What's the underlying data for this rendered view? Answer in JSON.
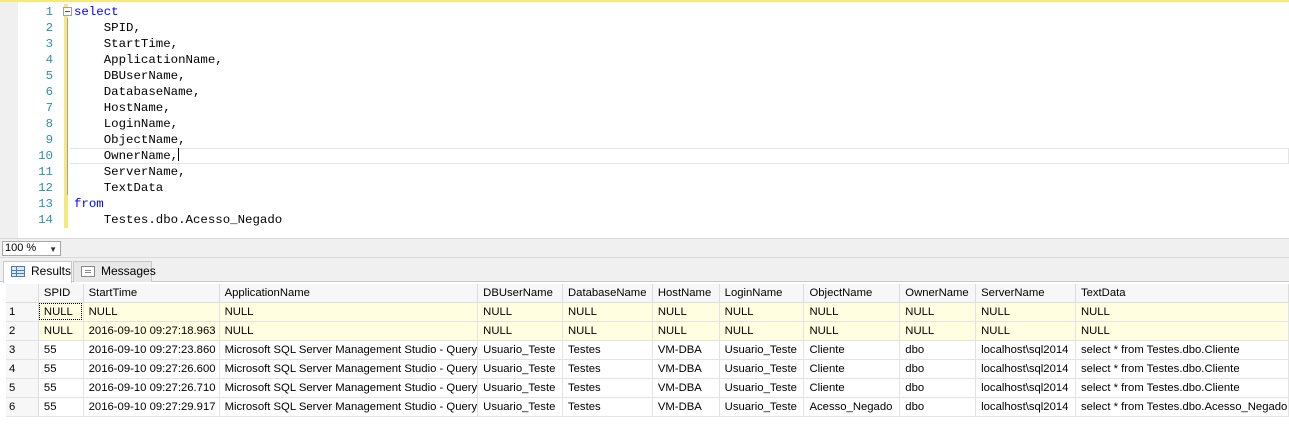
{
  "editor": {
    "lines": [
      {
        "n": "1",
        "kw": "select",
        "text": ""
      },
      {
        "n": "2",
        "kw": "",
        "text": "    SPID,"
      },
      {
        "n": "3",
        "kw": "",
        "text": "    StartTime,"
      },
      {
        "n": "4",
        "kw": "",
        "text": "    ApplicationName,"
      },
      {
        "n": "5",
        "kw": "",
        "text": "    DBUserName,"
      },
      {
        "n": "6",
        "kw": "",
        "text": "    DatabaseName,"
      },
      {
        "n": "7",
        "kw": "",
        "text": "    HostName,"
      },
      {
        "n": "8",
        "kw": "",
        "text": "    LoginName,"
      },
      {
        "n": "9",
        "kw": "",
        "text": "    ObjectName,"
      },
      {
        "n": "10",
        "kw": "",
        "text": "    OwnerName,"
      },
      {
        "n": "11",
        "kw": "",
        "text": "    ServerName,"
      },
      {
        "n": "12",
        "kw": "",
        "text": "    TextData"
      },
      {
        "n": "13",
        "kw": "from",
        "text": ""
      },
      {
        "n": "14",
        "kw": "",
        "text": "    Testes.dbo.Acesso_Negado"
      }
    ],
    "current_line": "10"
  },
  "zoom": {
    "value": "100 %"
  },
  "tabs": [
    {
      "label": "Results",
      "active": true
    },
    {
      "label": "Messages",
      "active": false
    }
  ],
  "grid": {
    "columns": [
      "SPID",
      "StartTime",
      "ApplicationName",
      "DBUserName",
      "DatabaseName",
      "HostName",
      "LoginName",
      "ObjectName",
      "OwnerName",
      "ServerName",
      "TextData"
    ],
    "rows": [
      {
        "num": "1",
        "cells": [
          "NULL",
          "NULL",
          "NULL",
          "NULL",
          "NULL",
          "NULL",
          "NULL",
          "NULL",
          "NULL",
          "NULL",
          "NULL"
        ]
      },
      {
        "num": "2",
        "cells": [
          "NULL",
          "2016-09-10 09:27:18.963",
          "NULL",
          "NULL",
          "NULL",
          "NULL",
          "NULL",
          "NULL",
          "NULL",
          "NULL",
          "NULL"
        ]
      },
      {
        "num": "3",
        "cells": [
          "55",
          "2016-09-10 09:27:23.860",
          "Microsoft SQL Server Management Studio - Query",
          "Usuario_Teste",
          "Testes",
          "VM-DBA",
          "Usuario_Teste",
          "Cliente",
          "dbo",
          "localhost\\sql2014",
          "select * from Testes.dbo.Cliente"
        ]
      },
      {
        "num": "4",
        "cells": [
          "55",
          "2016-09-10 09:27:26.600",
          "Microsoft SQL Server Management Studio - Query",
          "Usuario_Teste",
          "Testes",
          "VM-DBA",
          "Usuario_Teste",
          "Cliente",
          "dbo",
          "localhost\\sql2014",
          "select * from Testes.dbo.Cliente"
        ]
      },
      {
        "num": "5",
        "cells": [
          "55",
          "2016-09-10 09:27:26.710",
          "Microsoft SQL Server Management Studio - Query",
          "Usuario_Teste",
          "Testes",
          "VM-DBA",
          "Usuario_Teste",
          "Cliente",
          "dbo",
          "localhost\\sql2014",
          "select * from Testes.dbo.Cliente"
        ]
      },
      {
        "num": "6",
        "cells": [
          "55",
          "2016-09-10 09:27:29.917",
          "Microsoft SQL Server Management Studio - Query",
          "Usuario_Teste",
          "Testes",
          "VM-DBA",
          "Usuario_Teste",
          "Acesso_Negado",
          "dbo",
          "localhost\\sql2014",
          "select * from Testes.dbo.Acesso_Negado"
        ]
      }
    ],
    "selected_cell": {
      "row": "1",
      "column": "SPID"
    }
  },
  "colors": {
    "keyword": "#0000ff",
    "line_number": "#2b91af",
    "change_bar": "#f6e87c",
    "null_row_highlight": "#fffee0"
  },
  "icons": {
    "fold": "collapse-minus-icon",
    "results_tab": "grid-icon",
    "messages_tab": "messages-icon",
    "zoom_dropdown": "chevron-down-icon"
  }
}
